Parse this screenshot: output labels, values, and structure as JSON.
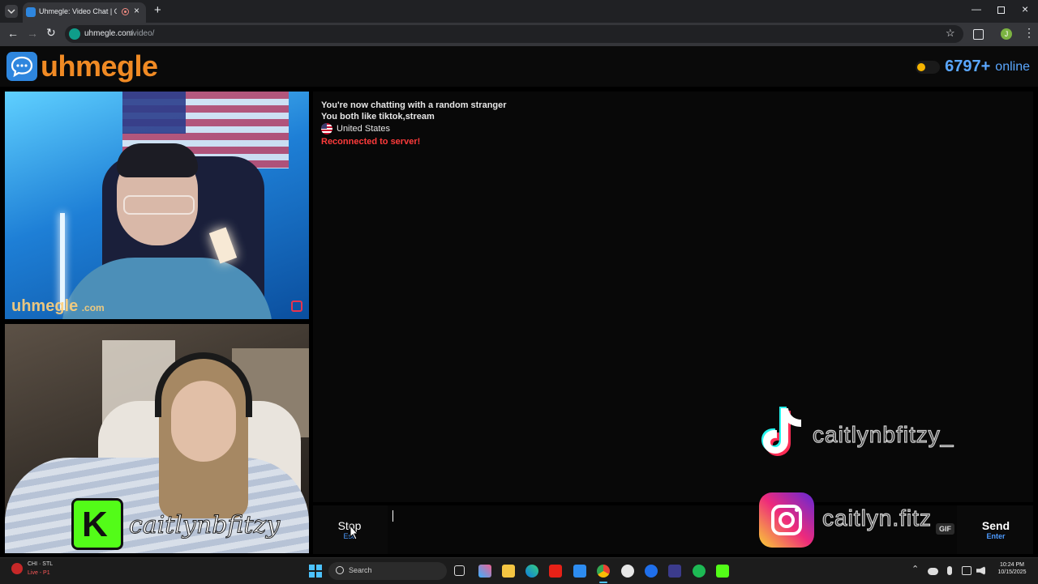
{
  "browser": {
    "tab_title": "Uhmegle: Video Chat | Om",
    "url_host": "uhmegle.com",
    "url_path": "/video/",
    "profile_initial": "J"
  },
  "site": {
    "logo_text": "uhmegle",
    "online_count": "6797+",
    "online_label": "online",
    "brand_color": "#f08a24",
    "accent_color": "#2e86de"
  },
  "video": {
    "stranger_watermark_main": "uhmegle",
    "stranger_watermark_suffix": ".com",
    "overlay_handle": "caitlynbfitzy"
  },
  "chat": {
    "messages": [
      {
        "text": "You're now chatting with a random stranger"
      },
      {
        "text": "You both like tiktok,stream"
      },
      {
        "text": "United States"
      },
      {
        "text": "Reconnected to server!"
      }
    ]
  },
  "overlays": {
    "tiktok_handle": "caitlynbfitzy_",
    "instagram_handle": "caitlyn.fitz"
  },
  "controls": {
    "stop_label": "Stop",
    "stop_hint": "Esc",
    "gif_label": "GIF",
    "send_label": "Send",
    "send_hint": "Enter"
  },
  "taskbar": {
    "weather_top": "CHI · STL",
    "weather_bottom": "Live - P1",
    "search_placeholder": "Search",
    "time": "10:24 PM",
    "date": "10/15/2025"
  }
}
